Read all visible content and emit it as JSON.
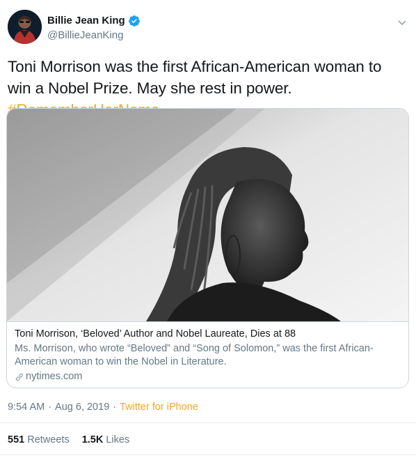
{
  "author": {
    "display_name": "Billie Jean King",
    "handle": "@BillieJeanKing",
    "verified_icon": "verified-badge-icon",
    "avatar_icon": "avatar"
  },
  "tweet": {
    "text": "Toni Morrison was the first African-American woman to win a Nobel Prize. May she rest in power. ",
    "hashtag": "#RememberHerName"
  },
  "card": {
    "title": "Toni Morrison, ‘Beloved’ Author and Nobel Laureate, Dies at 88",
    "description": "Ms. Morrison, who wrote “Beloved” and “Song of Solomon,” was the first African-American woman to win the Nobel in Literature.",
    "domain": "nytimes.com"
  },
  "meta": {
    "time": "9:54 AM",
    "separator1": "·",
    "date": "Aug 6, 2019",
    "separator2": "·",
    "source": "Twitter for iPhone"
  },
  "stats": {
    "retweets_count": "551",
    "retweets_label": "Retweets",
    "likes_count": "1.5K",
    "likes_label": "Likes"
  },
  "colors": {
    "accent": "#f5a623",
    "verified": "#1da1f2",
    "secondary_text": "#657786",
    "border": "#ccd6dd"
  }
}
